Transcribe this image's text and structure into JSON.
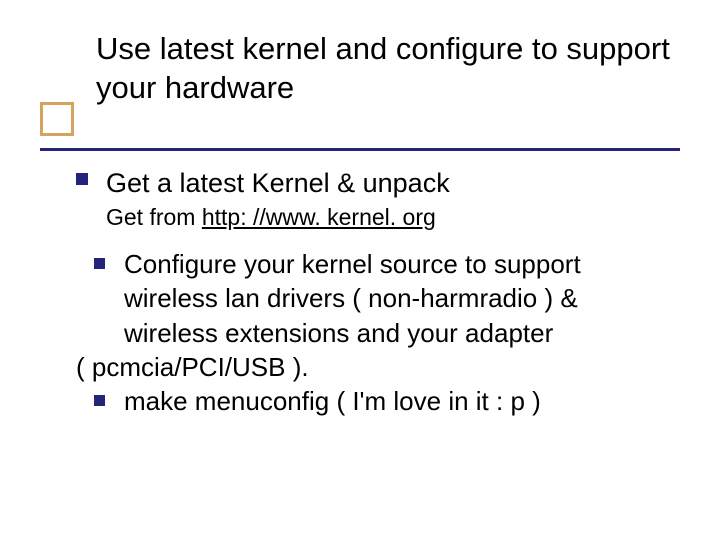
{
  "title": "Use latest kernel and configure to support your hardware",
  "items": [
    {
      "text": "Get a latest Kernel & unpack",
      "sub_prefix": "Get from ",
      "link_text": "http: //www. kernel. org",
      "link_href": "http://www.kernel.org"
    },
    {
      "text": "Configure your kernel source to support wireless lan drivers ( non-harmradio ) & wireless extensions and your adapter",
      "cont": " ( pcmcia/PCI/USB )."
    },
    {
      "text": "make menuconfig  ( I'm love in it : p )"
    }
  ]
}
